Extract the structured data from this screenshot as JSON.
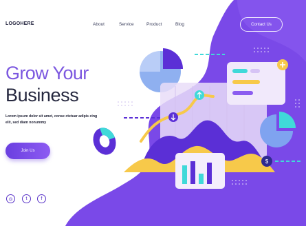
{
  "header": {
    "logo": "LOGOHERE",
    "nav": [
      "About",
      "Service",
      "Product",
      "Blog"
    ],
    "contact": "Contact Us"
  },
  "hero": {
    "title_line1": "Grow Your",
    "title_line2": "Business",
    "description": "Lorem ipsum dolor sit amet, conse ctetuar adipis cing elit, sed diam nonummy",
    "cta": "Join Us"
  },
  "social": {
    "icons": [
      "instagram-icon",
      "twitter-icon",
      "facebook-icon"
    ],
    "glyphs": [
      "◎",
      "t",
      "f"
    ]
  },
  "colors": {
    "purple": "#6a3fe0",
    "violet": "#8d5bf2",
    "yellow": "#f7c94a",
    "teal": "#40d9d9",
    "dark": "#26283f"
  }
}
